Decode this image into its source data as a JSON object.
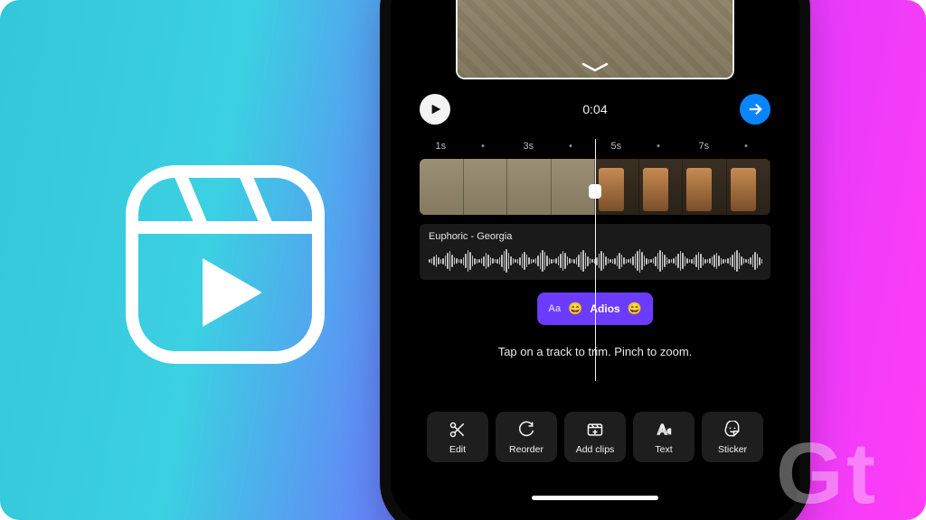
{
  "colors": {
    "accent_next": "#0a84ff",
    "chip": "#6b3cff"
  },
  "transport": {
    "time": "0:04"
  },
  "ruler": {
    "t1": "1s",
    "t3": "3s",
    "t5": "5s",
    "t7": "7s"
  },
  "audio": {
    "label": "Euphoric - Georgia"
  },
  "text_chip": {
    "prefix": "Aa",
    "emoji_left": "😄",
    "word": "Adios",
    "emoji_right": "😄"
  },
  "hint": {
    "text": "Tap on a track to trim. Pinch to zoom."
  },
  "toolbar": {
    "edit": "Edit",
    "reorder": "Reorder",
    "add_clips": "Add clips",
    "text": "Text",
    "sticker": "Sticker"
  },
  "watermark": {
    "text": "Gt"
  }
}
